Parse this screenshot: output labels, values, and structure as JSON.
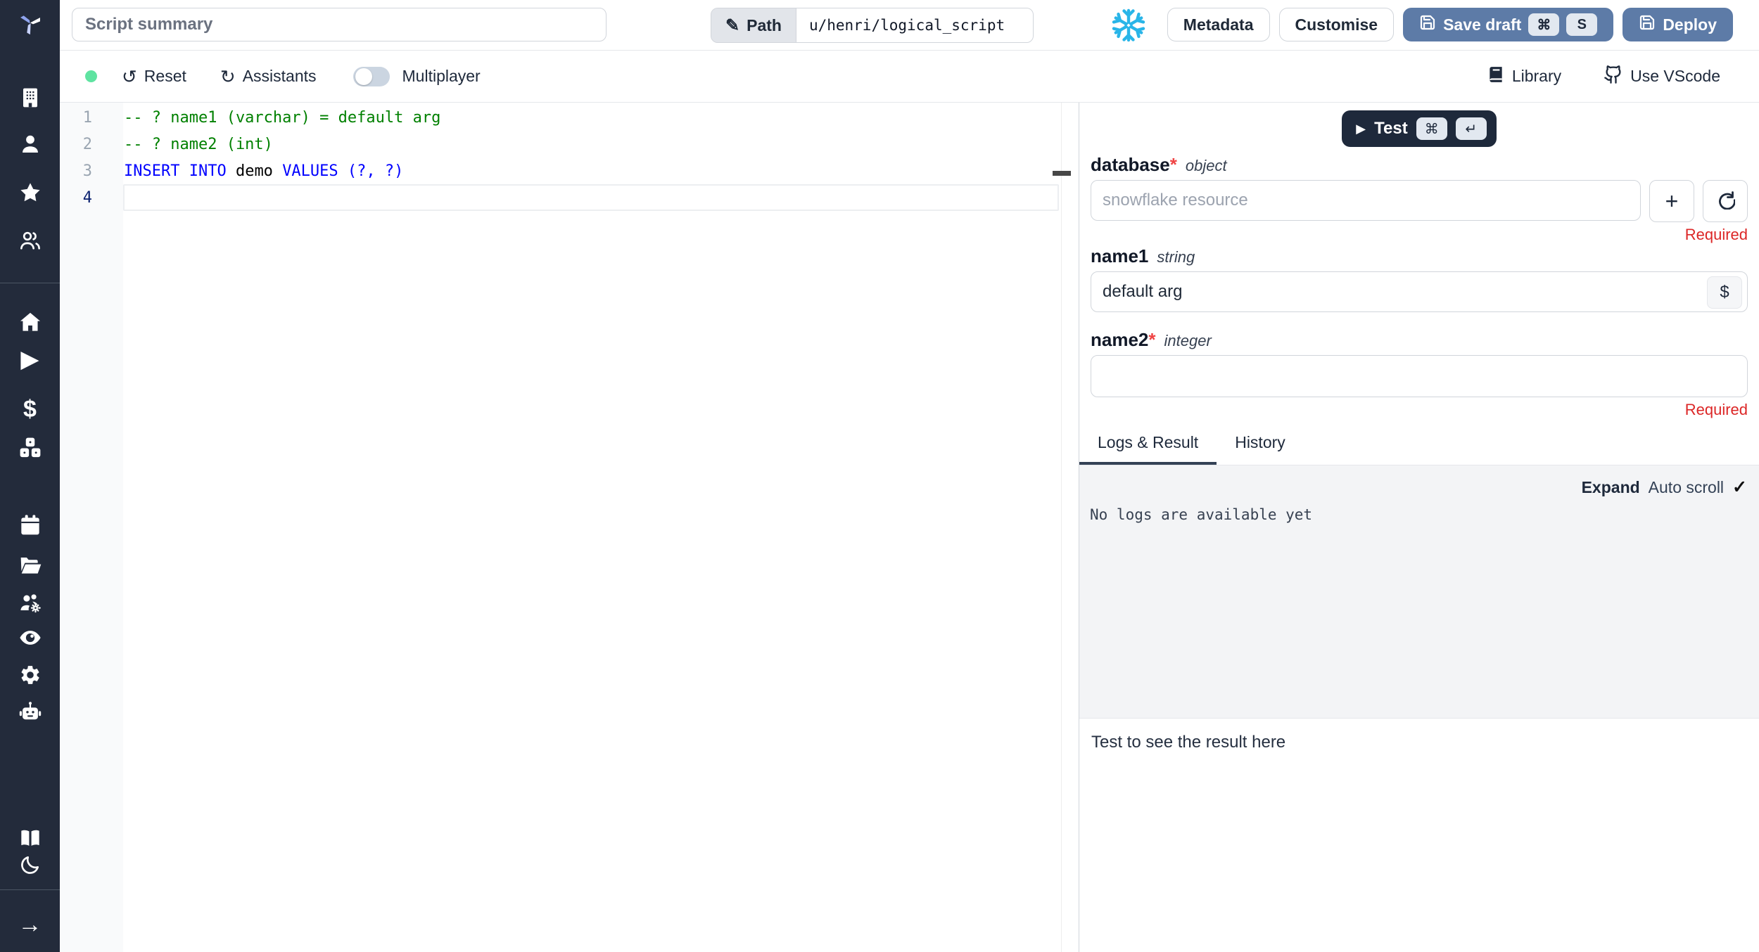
{
  "topbar": {
    "summary_placeholder": "Script summary",
    "path_label": "Path",
    "path_value": "u/henri/logical_script",
    "metadata_label": "Metadata",
    "customise_label": "Customise",
    "save_draft_label": "Save draft",
    "save_shortcut_mod": "⌘",
    "save_shortcut_key": "S",
    "deploy_label": "Deploy"
  },
  "toolbar": {
    "reset_label": "Reset",
    "assistants_label": "Assistants",
    "multiplayer_label": "Multiplayer",
    "library_label": "Library",
    "vscode_label": "Use VScode"
  },
  "editor": {
    "language": "sql",
    "lines": [
      {
        "number": "1",
        "active": false,
        "segments": [
          {
            "text": "-- ? name1 (varchar) = default arg",
            "style": "comment"
          }
        ]
      },
      {
        "number": "2",
        "active": false,
        "segments": [
          {
            "text": "-- ? name2 (int)",
            "style": "comment"
          }
        ]
      },
      {
        "number": "3",
        "active": false,
        "segments": [
          {
            "text": "INSERT INTO",
            "style": "keyword"
          },
          {
            "text": " demo ",
            "style": "plain"
          },
          {
            "text": "VALUES",
            "style": "keyword"
          },
          {
            "text": " (?, ?)",
            "style": "keyword"
          }
        ]
      },
      {
        "number": "4",
        "active": true,
        "segments": []
      }
    ]
  },
  "run_panel": {
    "test_label": "Test",
    "test_shortcut_mod": "⌘",
    "test_shortcut_enter": "↵",
    "required_star": "*",
    "required_label": "Required",
    "database": {
      "name": "database",
      "type": "object",
      "placeholder": "snowflake resource"
    },
    "name1": {
      "name": "name1",
      "type": "string",
      "value": "default arg",
      "dollar_label": "$"
    },
    "name2": {
      "name": "name2",
      "type": "integer"
    },
    "tabs": [
      "Logs & Result",
      "History"
    ],
    "expand_label": "Expand",
    "autoscroll_label": "Auto scroll",
    "autoscroll_check": "✓",
    "no_logs_text": "No logs are available yet",
    "result_hint": "Test to see the result here"
  },
  "sidebar": {
    "icons": [
      "windmill-logo",
      "building",
      "user",
      "star",
      "users",
      "home",
      "play",
      "dollar",
      "cubes",
      "calendar",
      "folder-open",
      "users-gear",
      "eye",
      "gear",
      "robot",
      "book-open",
      "moon",
      "arrow-right"
    ]
  },
  "colors": {
    "sidebar_bg": "#232b3b",
    "primary_button": "#5d7ba7",
    "dark_button": "#1e293b",
    "snowflake_blue": "#29b5e8",
    "comment_green": "#008000",
    "keyword_blue": "#0000ff",
    "required_red": "#dc2626",
    "online_dot_green": "#5fe3a1"
  }
}
